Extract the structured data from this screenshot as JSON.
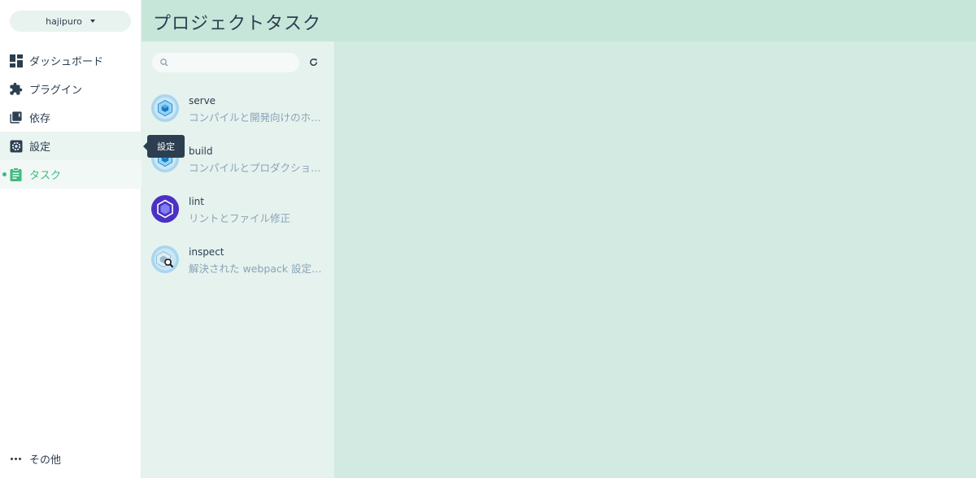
{
  "project": {
    "name": "hajipuro"
  },
  "sidebar": {
    "items": [
      {
        "label": "ダッシュボード",
        "icon": "dashboard-icon"
      },
      {
        "label": "プラグイン",
        "icon": "puzzle-icon"
      },
      {
        "label": "依存",
        "icon": "library-icon"
      },
      {
        "label": "設定",
        "icon": "settings-icon"
      },
      {
        "label": "タスク",
        "icon": "clipboard-icon"
      }
    ],
    "more_label": "その他"
  },
  "tooltip": {
    "text": "設定"
  },
  "header": {
    "title": "プロジェクトタスク"
  },
  "search": {
    "placeholder": "",
    "value": ""
  },
  "tasks": [
    {
      "name": "serve",
      "description": "コンパイルと開発向けのホ…",
      "icon": "webpack-icon"
    },
    {
      "name": "build",
      "description": "コンパイルとプロダクショ…",
      "icon": "webpack-icon"
    },
    {
      "name": "lint",
      "description": "リントとファイル修正",
      "icon": "eslint-icon"
    },
    {
      "name": "inspect",
      "description": "解決された webpack 設定…",
      "icon": "webpack-inspect-icon"
    }
  ],
  "colors": {
    "accent": "#42b983",
    "header_bg": "#c7e6da",
    "panel_bg": "#e6f2ee",
    "main_bg": "#d2eae1",
    "text": "#2c3e50",
    "muted": "#8aa3b5"
  }
}
